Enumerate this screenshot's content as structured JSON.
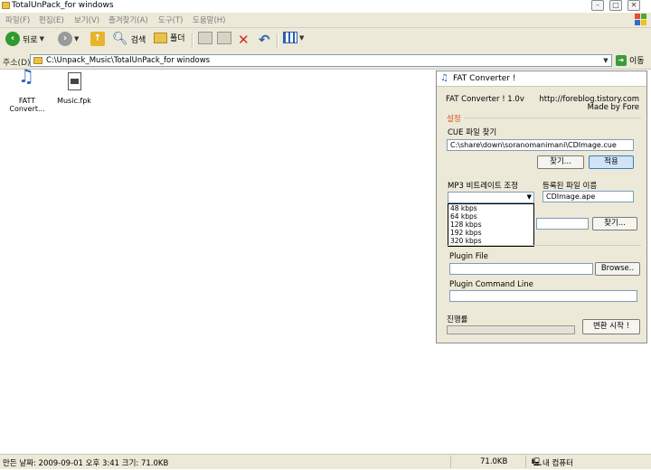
{
  "window": {
    "title": "TotalUnPack_for windows"
  },
  "menu": [
    "파일(F)",
    "편집(E)",
    "보기(V)",
    "즐겨찾기(A)",
    "도구(T)",
    "도움말(H)"
  ],
  "toolbar": {
    "back_label": "뒤로",
    "search_label": "검색",
    "folders_label": "폴더"
  },
  "address": {
    "label": "주소(D)",
    "path": "C:\\Unpack_Music\\TotalUnPack_for windows",
    "go_label": "이동"
  },
  "files": [
    {
      "name": "FATT\nConvert...",
      "icon": "music-notes-icon"
    },
    {
      "name": "Music.fpk",
      "icon": "document-icon"
    }
  ],
  "status": {
    "modified": "만든 날짜: 2009-09-01 오후 3:41 크기: 71.0KB",
    "size": "71.0KB",
    "location": "내 컴퓨터"
  },
  "dialog": {
    "title": "FAT Converter !",
    "version": "FAT Converter ! 1.0v",
    "url": "http://foreblog.tistory.com",
    "made_by": "Made by Fore",
    "settings_label": "설정",
    "cue_label": "CUE 파일 찾기",
    "cue_path": "C:\\share\\down\\soranomanimani\\CDImage.cue",
    "find_button": "찾기...",
    "apply_button": "적용",
    "bitrate_label": "MP3 비트레이트 조정",
    "registered_label": "등록된 파일 이름",
    "registered_value": "CDImage.ape",
    "bitrate_options": [
      "48 kbps",
      "64 kbps",
      "128 kbps",
      "192 kbps",
      "320 kbps"
    ],
    "find_button2": "찾기...",
    "plugin_file_label": "Plugin File",
    "browse_button": "Browse..",
    "plugin_cmd_label": "Plugin Command Line",
    "progress_label": "진행률",
    "progress_value": 0,
    "convert_button": "변환 시작 !"
  }
}
